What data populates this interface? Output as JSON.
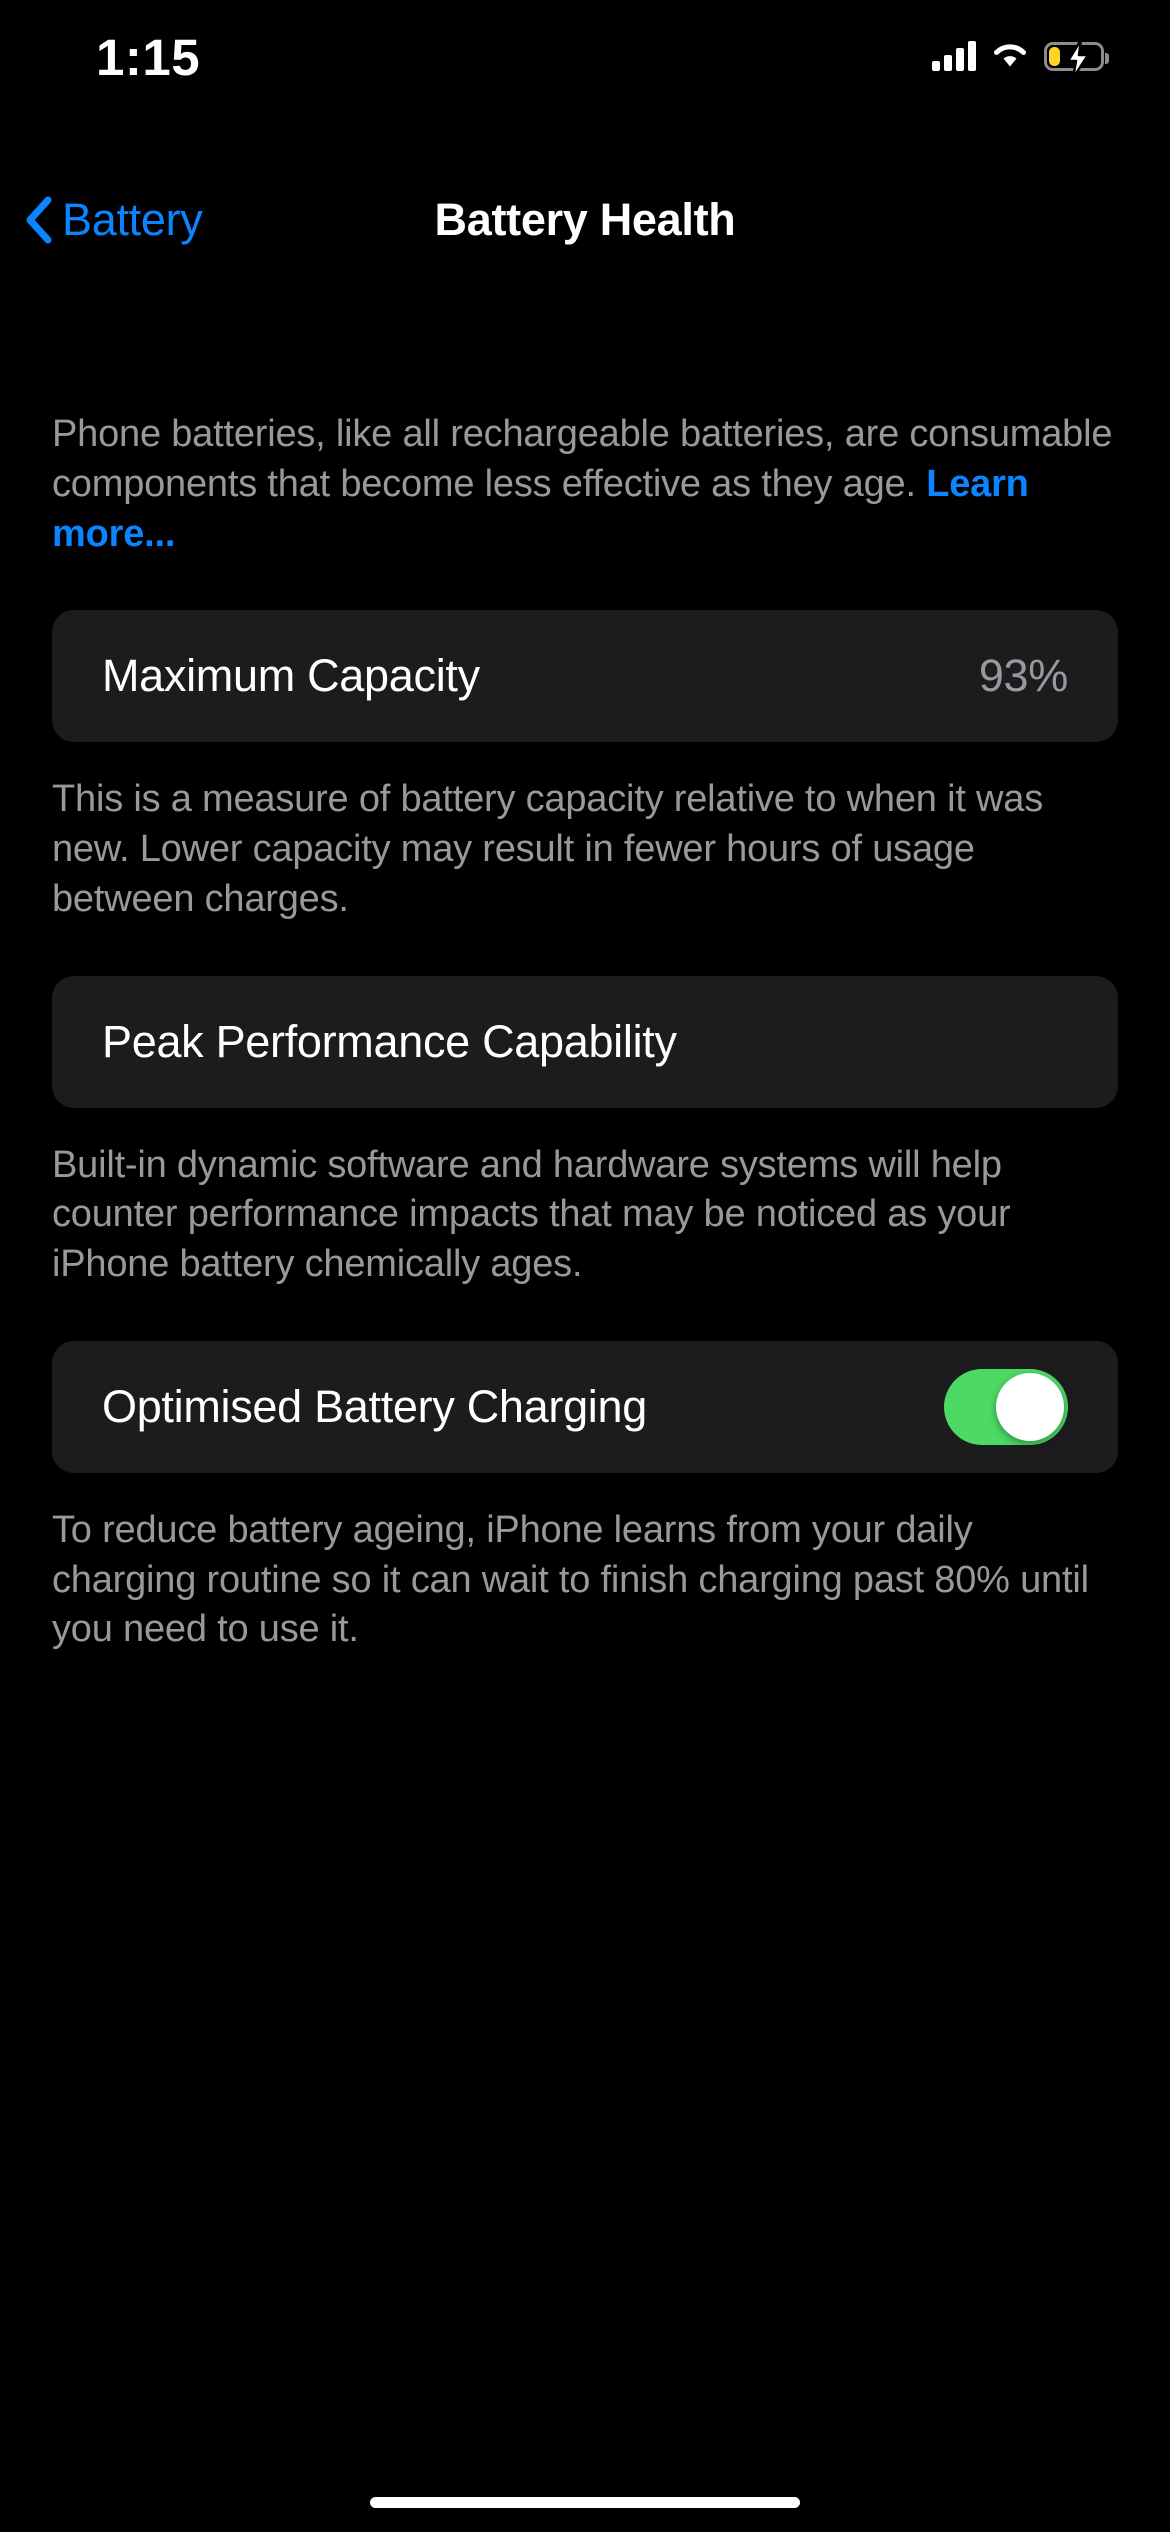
{
  "status_bar": {
    "time": "1:15",
    "cellular_icon": "cellular-signal-icon",
    "wifi_icon": "wifi-icon",
    "battery_icon": "battery-charging-icon",
    "battery_state": "charging",
    "battery_color": "#ffd426"
  },
  "nav": {
    "back_label": "Battery",
    "back_icon": "chevron-left-icon",
    "title": "Battery Health",
    "accent_color": "#0a84ff"
  },
  "intro": {
    "text": "Phone batteries, like all rechargeable batteries, are consumable components that become less effective as they age. ",
    "link_label": "Learn more..."
  },
  "maximum_capacity": {
    "title": "Maximum Capacity",
    "value": "93%",
    "footnote": "This is a measure of battery capacity relative to when it was new. Lower capacity may result in fewer hours of usage between charges."
  },
  "peak_performance": {
    "title": "Peak Performance Capability",
    "footnote": "Built-in dynamic software and hardware systems will help counter performance impacts that may be noticed as your iPhone battery chemically ages."
  },
  "optimised_charging": {
    "title": "Optimised Battery Charging",
    "toggle_state": "on",
    "toggle_color": "#4cd964",
    "footnote": "To reduce battery ageing, iPhone learns from your daily charging routine so it can wait to finish charging past 80% until you need to use it."
  },
  "colors": {
    "background": "#000000",
    "card": "#1c1c1e",
    "secondary_text": "#98989d",
    "primary_text": "#ffffff"
  }
}
